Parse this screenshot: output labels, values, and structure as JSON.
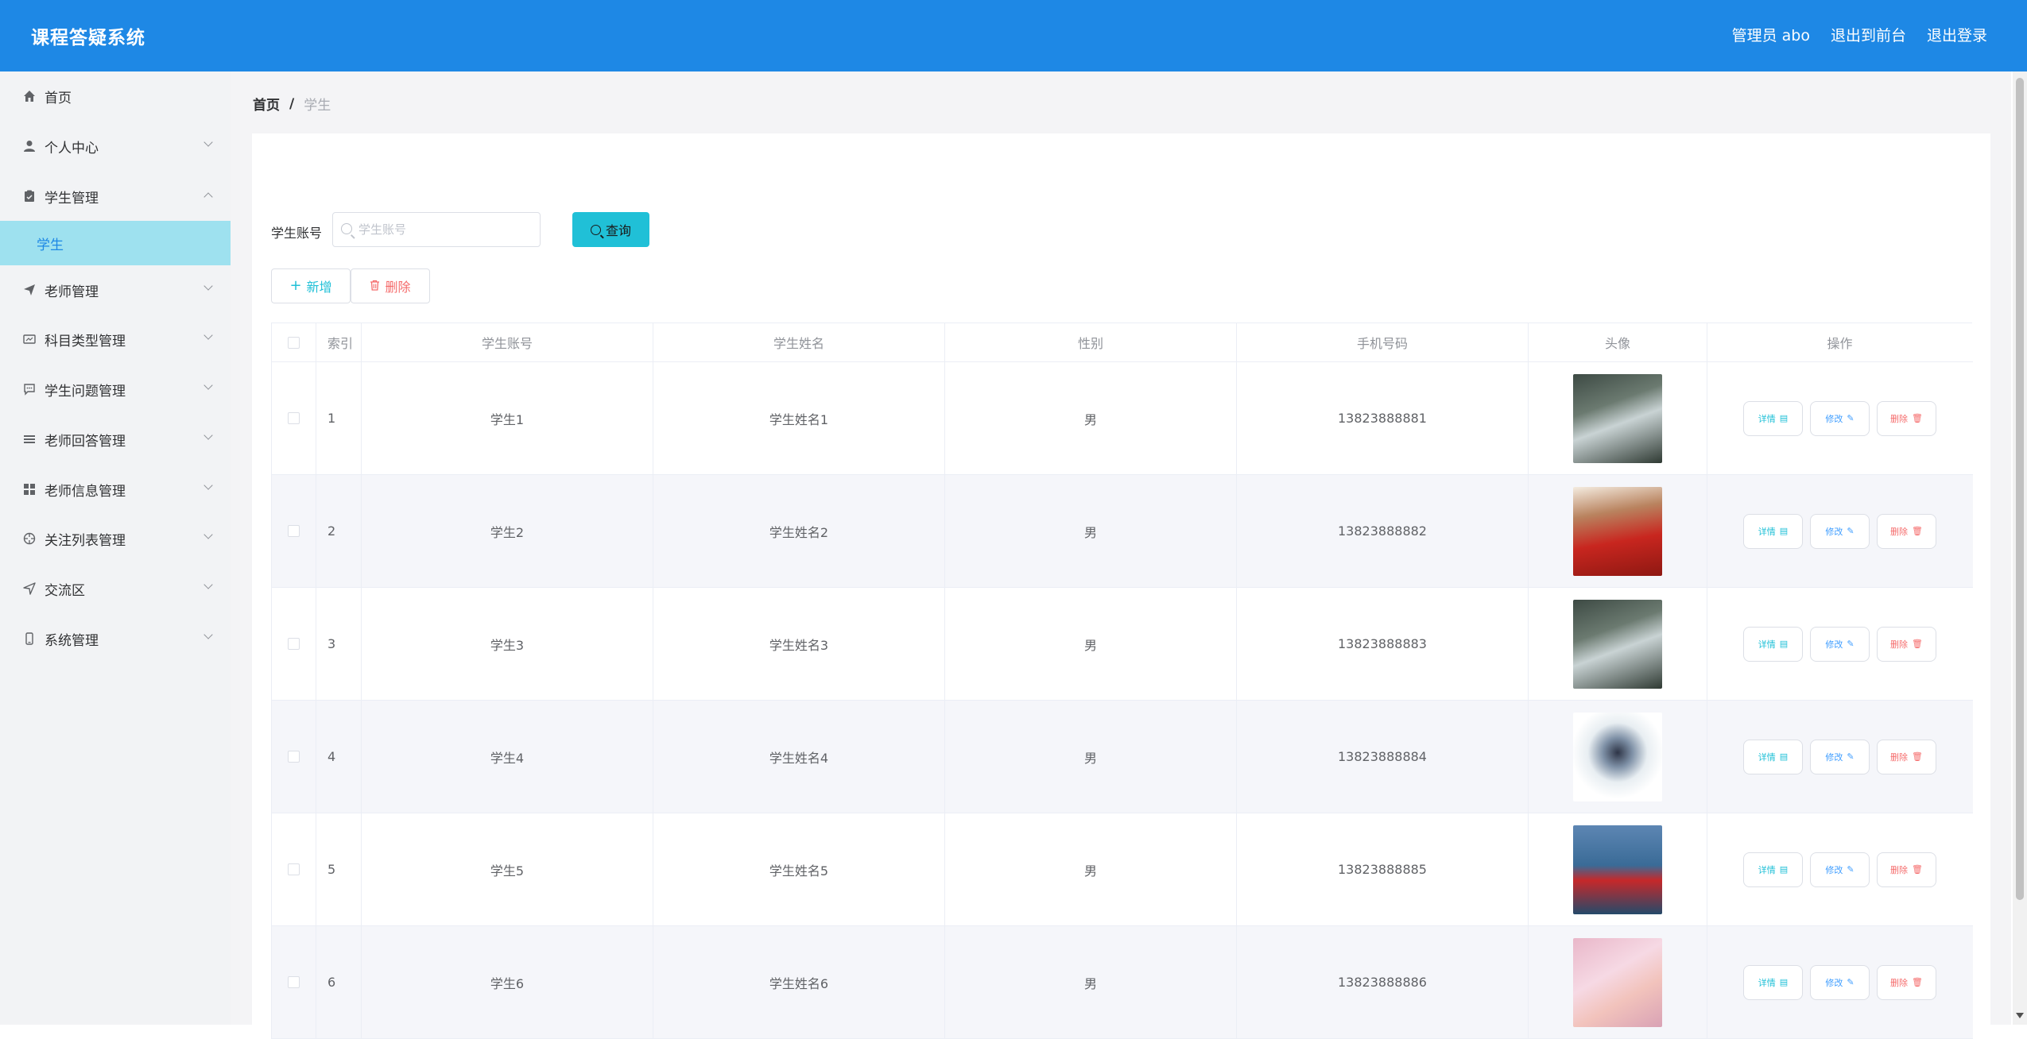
{
  "header": {
    "title": "课程答疑系统",
    "admin": "管理员 abo",
    "to_front": "退出到前台",
    "logout": "退出登录"
  },
  "sidebar": {
    "items": [
      {
        "label": "首页",
        "icon": "home-icon"
      },
      {
        "label": "个人中心",
        "icon": "user-icon"
      },
      {
        "label": "学生管理",
        "icon": "clipboard-icon",
        "expanded": true
      },
      {
        "label": "老师管理",
        "icon": "send-icon"
      },
      {
        "label": "科目类型管理",
        "icon": "card-icon"
      },
      {
        "label": "学生问题管理",
        "icon": "chat-icon"
      },
      {
        "label": "老师回答管理",
        "icon": "list-icon"
      },
      {
        "label": "老师信息管理",
        "icon": "grid-icon"
      },
      {
        "label": "关注列表管理",
        "icon": "aperture-icon"
      },
      {
        "label": "交流区",
        "icon": "navigation-icon"
      },
      {
        "label": "系统管理",
        "icon": "phone-icon"
      }
    ],
    "active_sub": "学生"
  },
  "breadcrumb": {
    "home": "首页",
    "sep": "/",
    "current": "学生"
  },
  "search": {
    "label": "学生账号",
    "placeholder": "学生账号",
    "query_button": "查询"
  },
  "toolbar": {
    "add": "新增",
    "delete": "删除"
  },
  "table": {
    "columns": [
      "索引",
      "学生账号",
      "学生姓名",
      "性别",
      "手机号码",
      "头像",
      "操作"
    ],
    "rows": [
      {
        "index": "1",
        "account": "学生1",
        "name": "学生姓名1",
        "gender": "男",
        "phone": "13823888881"
      },
      {
        "index": "2",
        "account": "学生2",
        "name": "学生姓名2",
        "gender": "男",
        "phone": "13823888882"
      },
      {
        "index": "3",
        "account": "学生3",
        "name": "学生姓名3",
        "gender": "男",
        "phone": "13823888883"
      },
      {
        "index": "4",
        "account": "学生4",
        "name": "学生姓名4",
        "gender": "男",
        "phone": "13823888884"
      },
      {
        "index": "5",
        "account": "学生5",
        "name": "学生姓名5",
        "gender": "男",
        "phone": "13823888885"
      },
      {
        "index": "6",
        "account": "学生6",
        "name": "学生姓名6",
        "gender": "男",
        "phone": "13823888886"
      }
    ],
    "actions": {
      "detail": "详情",
      "edit": "修改",
      "remove": "删除"
    }
  },
  "colors": {
    "header_bg": "#1e88e5",
    "sidebar_active_bg": "#9ee1ef",
    "accent_cyan": "#20c0d7",
    "danger": "#f56c6c",
    "edit_blue": "#409eff"
  }
}
